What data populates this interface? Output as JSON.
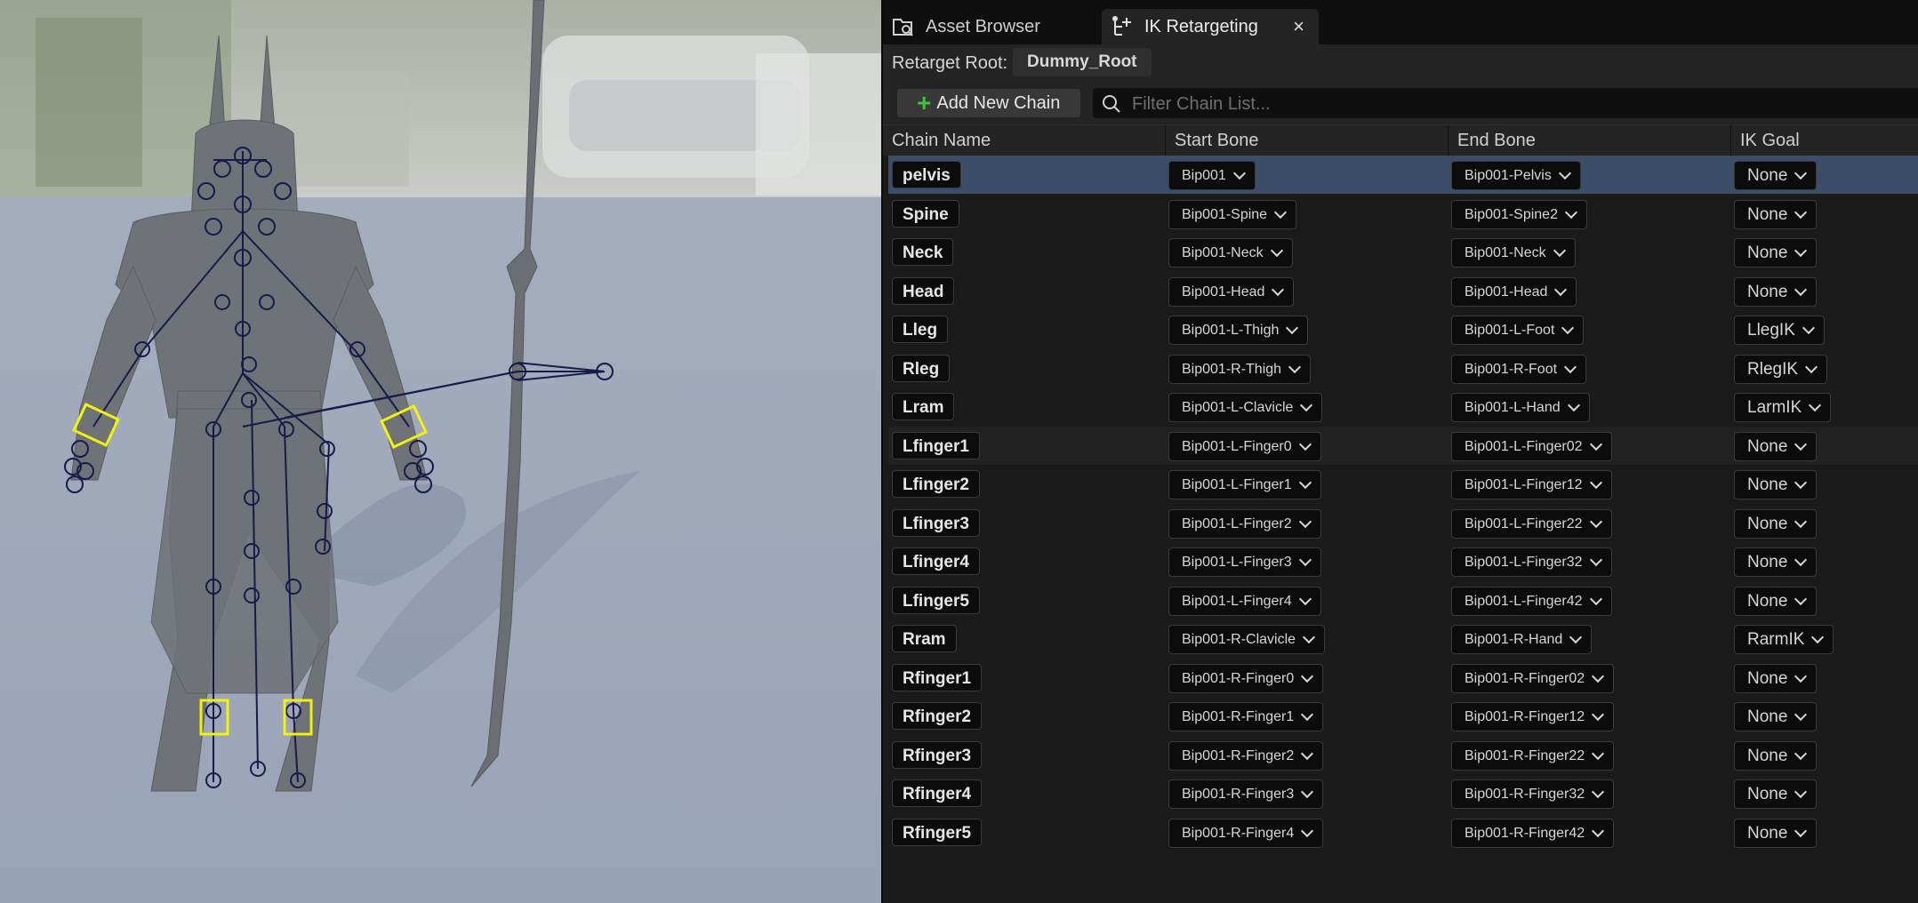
{
  "tabs": [
    {
      "label": "Asset Browser",
      "icon": "asset-browser-icon"
    },
    {
      "label": "IK Retargeting",
      "icon": "ik-retargeting-icon",
      "close": "×"
    }
  ],
  "retarget_root": {
    "label": "Retarget Root:",
    "value": "Dummy_Root"
  },
  "toolbar": {
    "add_chain_label": "Add New Chain"
  },
  "search": {
    "placeholder": "Filter Chain List..."
  },
  "columns": [
    "Chain Name",
    "Start Bone",
    "End Bone",
    "IK Goal"
  ],
  "chains": [
    {
      "name": "pelvis",
      "start": "Bip001",
      "end": "Bip001-Pelvis",
      "goal": "None"
    },
    {
      "name": "Spine",
      "start": "Bip001-Spine",
      "end": "Bip001-Spine2",
      "goal": "None"
    },
    {
      "name": "Neck",
      "start": "Bip001-Neck",
      "end": "Bip001-Neck",
      "goal": "None"
    },
    {
      "name": "Head",
      "start": "Bip001-Head",
      "end": "Bip001-Head",
      "goal": "None"
    },
    {
      "name": "Lleg",
      "start": "Bip001-L-Thigh",
      "end": "Bip001-L-Foot",
      "goal": "LlegIK"
    },
    {
      "name": "Rleg",
      "start": "Bip001-R-Thigh",
      "end": "Bip001-R-Foot",
      "goal": "RlegIK"
    },
    {
      "name": "Lram",
      "start": "Bip001-L-Clavicle",
      "end": "Bip001-L-Hand",
      "goal": "LarmIK"
    },
    {
      "name": "Lfinger1",
      "start": "Bip001-L-Finger0",
      "end": "Bip001-L-Finger02",
      "goal": "None"
    },
    {
      "name": "Lfinger2",
      "start": "Bip001-L-Finger1",
      "end": "Bip001-L-Finger12",
      "goal": "None"
    },
    {
      "name": "Lfinger3",
      "start": "Bip001-L-Finger2",
      "end": "Bip001-L-Finger22",
      "goal": "None"
    },
    {
      "name": "Lfinger4",
      "start": "Bip001-L-Finger3",
      "end": "Bip001-L-Finger32",
      "goal": "None"
    },
    {
      "name": "Lfinger5",
      "start": "Bip001-L-Finger4",
      "end": "Bip001-L-Finger42",
      "goal": "None"
    },
    {
      "name": "Rram",
      "start": "Bip001-R-Clavicle",
      "end": "Bip001-R-Hand",
      "goal": "RarmIK"
    },
    {
      "name": "Rfinger1",
      "start": "Bip001-R-Finger0",
      "end": "Bip001-R-Finger02",
      "goal": "None"
    },
    {
      "name": "Rfinger2",
      "start": "Bip001-R-Finger1",
      "end": "Bip001-R-Finger12",
      "goal": "None"
    },
    {
      "name": "Rfinger3",
      "start": "Bip001-R-Finger2",
      "end": "Bip001-R-Finger22",
      "goal": "None"
    },
    {
      "name": "Rfinger4",
      "start": "Bip001-R-Finger3",
      "end": "Bip001-R-Finger32",
      "goal": "None"
    },
    {
      "name": "Rfinger5",
      "start": "Bip001-R-Finger4",
      "end": "Bip001-R-Finger42",
      "goal": "None"
    }
  ],
  "selected_row": 0,
  "hovered_row": 7,
  "colors": {
    "selection": "#3b4d68",
    "bone_lines": "#1a1a4a",
    "ik_handles": "#f2f20a",
    "add_icon": "#3fbf3f"
  }
}
